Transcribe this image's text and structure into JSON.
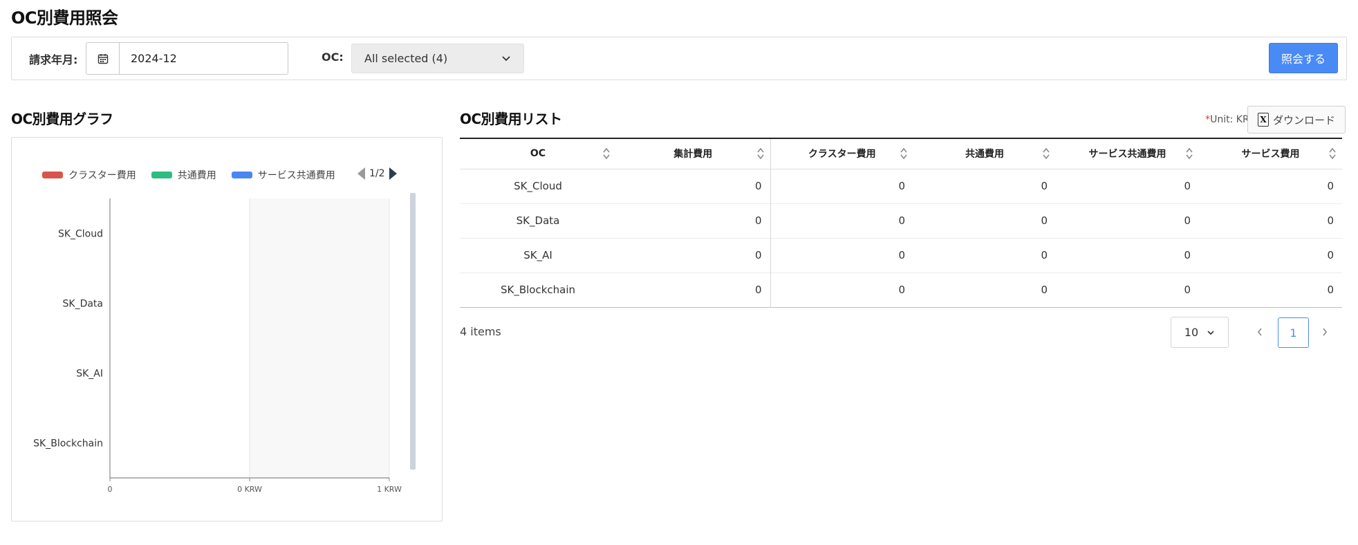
{
  "page": {
    "title": "OC別費用照会"
  },
  "filters": {
    "billing_month_label": "請求年月:",
    "billing_month_value": "2024-12",
    "oc_label": "OC:",
    "oc_selected": "All selected (4)",
    "search_button": "照会する"
  },
  "graph": {
    "title": "OC別費用グラフ",
    "legend": [
      {
        "label": "クラスター費用",
        "color": "#d9534f"
      },
      {
        "label": "共通費用",
        "color": "#2dbd82"
      },
      {
        "label": "サービス共通費用",
        "color": "#4a86f2"
      }
    ],
    "legend_pager": "1/2"
  },
  "chart_data": {
    "type": "bar",
    "orientation": "horizontal",
    "stacked": true,
    "categories": [
      "SK_Cloud",
      "SK_Data",
      "SK_AI",
      "SK_Blockchain"
    ],
    "series": [
      {
        "name": "クラスター費用",
        "values": [
          0,
          0,
          0,
          0
        ]
      },
      {
        "name": "共通費用",
        "values": [
          0,
          0,
          0,
          0
        ]
      },
      {
        "name": "サービス共通費用",
        "values": [
          0,
          0,
          0,
          0
        ]
      }
    ],
    "x_ticks": [
      "0",
      "0 KRW",
      "1 KRW"
    ],
    "xlim": [
      0,
      1
    ],
    "legend_position": "top"
  },
  "list": {
    "title": "OC別費用リスト",
    "unit_prefix": "*",
    "unit_text": "Unit: KRW",
    "download_button": "ダウンロード",
    "columns": [
      "OC",
      "集計費用",
      "クラスター費用",
      "共通費用",
      "サービス共通費用",
      "サービス費用"
    ],
    "rows": [
      [
        "SK_Cloud",
        "0",
        "0",
        "0",
        "0",
        "0"
      ],
      [
        "SK_Data",
        "0",
        "0",
        "0",
        "0",
        "0"
      ],
      [
        "SK_AI",
        "0",
        "0",
        "0",
        "0",
        "0"
      ],
      [
        "SK_Blockchain",
        "0",
        "0",
        "0",
        "0",
        "0"
      ]
    ],
    "items_count": "4 items",
    "page_size": "10",
    "current_page": "1"
  }
}
